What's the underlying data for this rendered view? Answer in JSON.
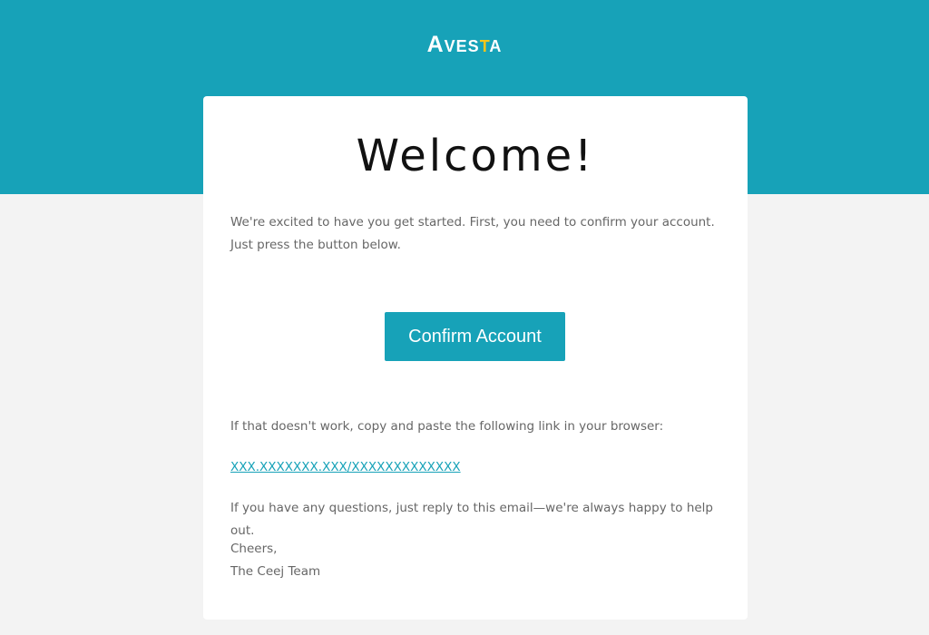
{
  "brand": {
    "logo_first": "A",
    "logo_mid": "VES",
    "logo_t": "T",
    "logo_last": "A",
    "color": "#17a2b8",
    "accent": "#f4c51b"
  },
  "email": {
    "title": "Welcome!",
    "intro": "We're excited to have you get started. First, you need to confirm your account. Just press the button below.",
    "button_label": "Confirm Account",
    "fallback_text": "If that doesn't work, copy and paste the following link in your browser:",
    "link_text": "XXX.XXXXXXX.XXX/XXXXXXXXXXXXX",
    "questions_text": "If you have any questions, just reply to this email—we're always happy to help out.",
    "signoff_line1": "Cheers,",
    "signoff_line2": "The Ceej Team"
  }
}
